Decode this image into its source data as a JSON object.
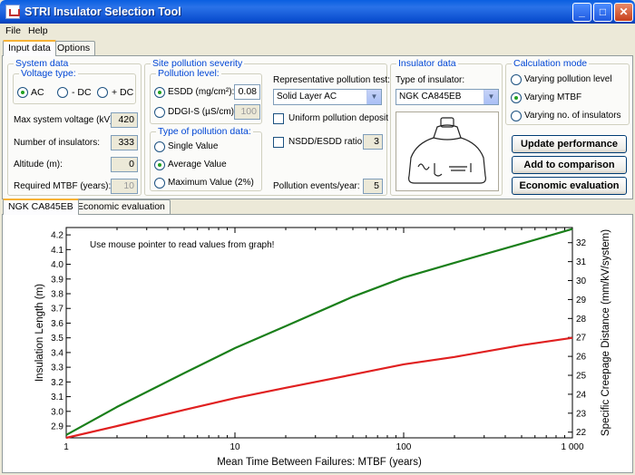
{
  "window": {
    "title": "STRI Insulator Selection Tool"
  },
  "menu": {
    "file": "File",
    "help": "Help"
  },
  "tabs": {
    "input_data": "Input data",
    "options": "Options"
  },
  "system_data": {
    "title": "System data",
    "voltage_type": {
      "title": "Voltage type:",
      "ac": "AC",
      "minus_dc": "- DC",
      "plus_dc": "+ DC"
    },
    "max_voltage_label": "Max system voltage (kV):",
    "max_voltage_value": "420",
    "num_insulators_label": "Number of insulators:",
    "num_insulators_value": "333",
    "altitude_label": "Altitude (m):",
    "altitude_value": "0",
    "mtbf_label": "Required MTBF (years):",
    "mtbf_value": "10"
  },
  "site_pollution": {
    "title": "Site pollution severity",
    "pollution_level": {
      "title": "Pollution level:",
      "esdd_label": "ESDD (mg/cm²):",
      "esdd_value": "0.08",
      "ddgi_label": "DDGI-S (µS/cm):",
      "ddgi_value": "100"
    },
    "type_data": {
      "title": "Type of pollution data:",
      "single": "Single Value",
      "average": "Average Value",
      "maximum": "Maximum Value (2%)"
    },
    "rep_test_label": "Representative pollution test:",
    "rep_test_value": "Solid Layer AC",
    "uniform_label": "Uniform pollution deposit",
    "nsdd_label": "NSDD/ESDD ratio:",
    "nsdd_value": "3",
    "events_label": "Pollution events/year:",
    "events_value": "5"
  },
  "insulator_data": {
    "title": "Insulator data",
    "type_label": "Type of insulator:",
    "type_value": "NGK CA845EB"
  },
  "calc_mode": {
    "title": "Calculation mode",
    "varying_pollution": "Varying pollution level",
    "varying_mtbf": "Varying MTBF",
    "varying_number": "Varying no. of insulators"
  },
  "buttons": {
    "update": "Update performance",
    "add": "Add to comparison",
    "economic": "Economic evaluation"
  },
  "lower_tabs": {
    "ngk": "NGK CA845EB",
    "economic": "Economic evaluation"
  },
  "colors": {
    "green_series": "#1a7f1a",
    "red_series": "#e02020"
  },
  "chart_data": {
    "type": "line",
    "annotation": "Use mouse pointer to read values from graph!",
    "xlabel": "Mean Time Between Failures: MTBF (years)",
    "ylabel": "Insulation Length (m)",
    "y2label": "Specific Creepage Distance (mm/kV/system)",
    "xscale": "log",
    "xlim": [
      1,
      1000
    ],
    "ylim": [
      2.82,
      4.25
    ],
    "y2lim": [
      21.7,
      32.8
    ],
    "xticks": [
      1,
      10,
      100,
      1000
    ],
    "xtick_labels": [
      "1",
      "10",
      "100",
      "1 000"
    ],
    "yticks": [
      "2.9",
      "3.0",
      "3.1",
      "3.2",
      "3.3",
      "3.4",
      "3.5",
      "3.6",
      "3.7",
      "3.8",
      "3.9",
      "4.0",
      "4.1",
      "4.2"
    ],
    "y2ticks": [
      "22",
      "23",
      "24",
      "25",
      "26",
      "27",
      "28",
      "29",
      "30",
      "31",
      "32"
    ],
    "series": [
      {
        "color": "green",
        "x": [
          1,
          2,
          5,
          10,
          20,
          50,
          100,
          200,
          500,
          1000
        ],
        "y": [
          2.84,
          3.03,
          3.26,
          3.43,
          3.58,
          3.78,
          3.91,
          4.01,
          4.14,
          4.24
        ]
      },
      {
        "color": "red",
        "x": [
          1,
          2,
          5,
          10,
          20,
          50,
          100,
          200,
          500,
          1000
        ],
        "y": [
          2.82,
          2.9,
          3.01,
          3.09,
          3.16,
          3.25,
          3.32,
          3.37,
          3.45,
          3.5
        ]
      }
    ]
  }
}
